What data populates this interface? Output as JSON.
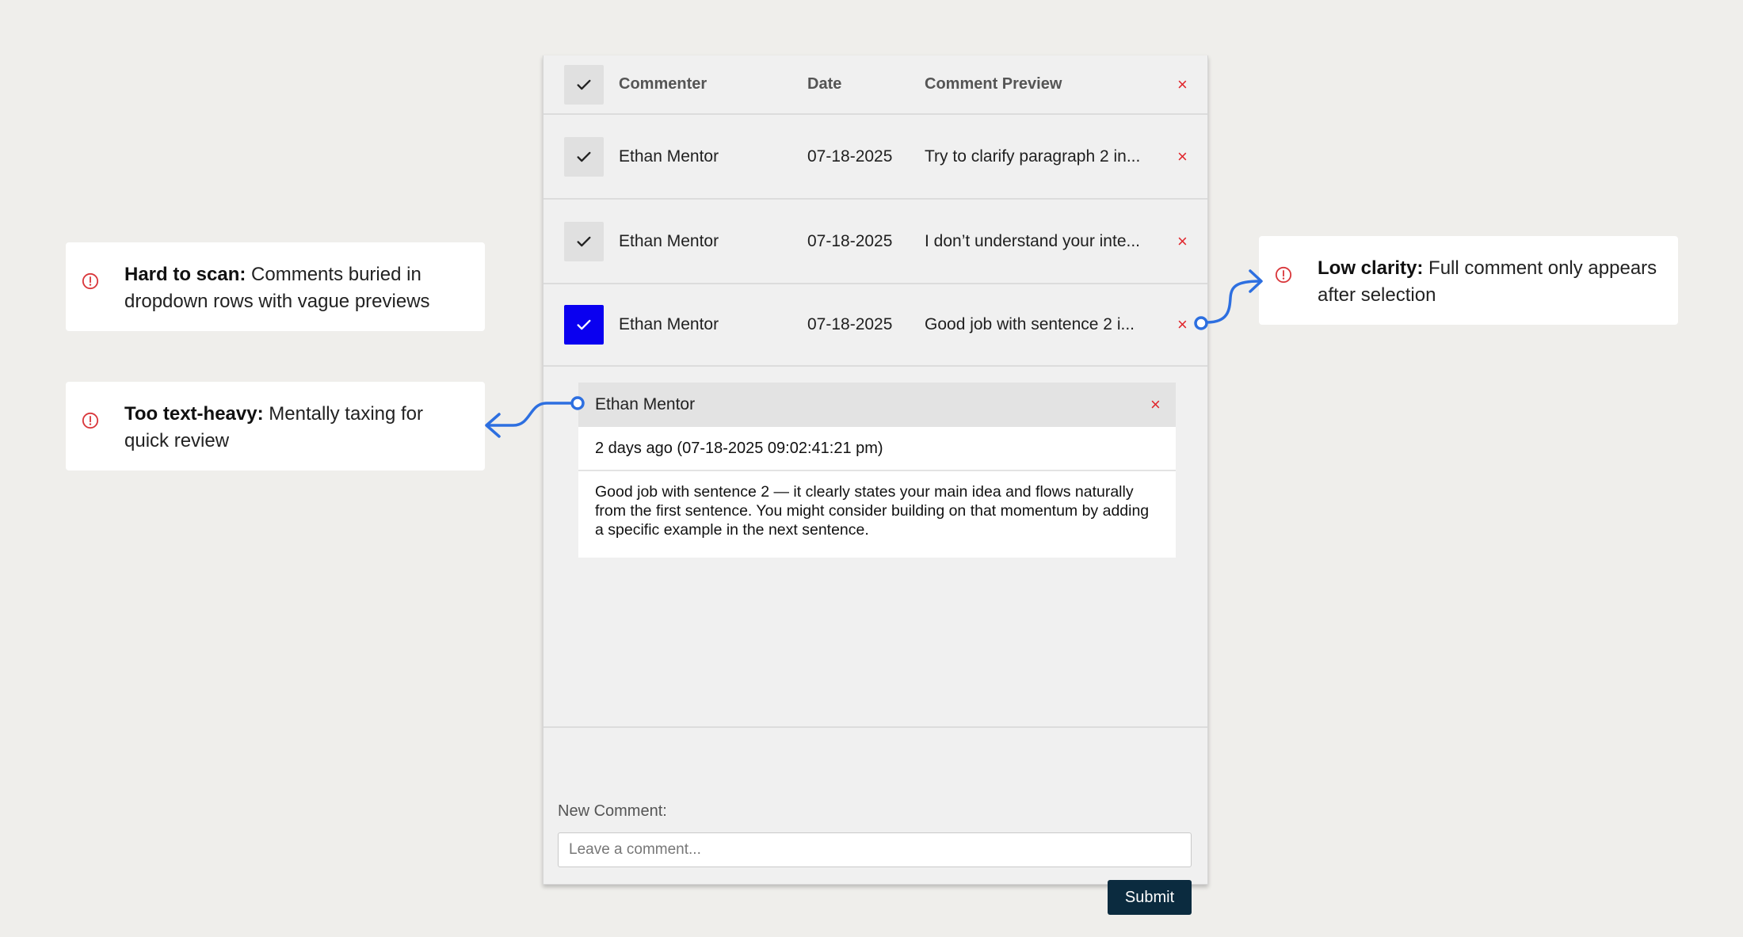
{
  "table": {
    "header": {
      "commenter": "Commenter",
      "date": "Date",
      "preview": "Comment Preview",
      "remove": "×"
    },
    "rows": [
      {
        "commenter": "Ethan Mentor",
        "date": "07-18-2025",
        "preview": "Try to clarify paragraph 2 in...",
        "remove": "×",
        "checked": false
      },
      {
        "commenter": "Ethan Mentor",
        "date": "07-18-2025",
        "preview": "I don’t understand your inte...",
        "remove": "×",
        "checked": false
      },
      {
        "commenter": "Ethan Mentor",
        "date": "07-18-2025",
        "preview": "Good job with sentence 2 i...",
        "remove": "×",
        "checked": true
      }
    ]
  },
  "detail": {
    "commenter": "Ethan Mentor",
    "close": "×",
    "timestamp": "2 days ago (07-18-2025 09:02:41:21 pm)",
    "body": "Good job with sentence 2 — it clearly states your main idea and flows naturally from the first sentence. You might consider building on that momentum by adding a specific example in the next sentence."
  },
  "new_comment": {
    "label": "New Comment:",
    "placeholder": "Leave a comment...",
    "value": "",
    "submit_label": "Submit"
  },
  "callouts": [
    {
      "title": "Hard to scan:",
      "text": " Comments buried in dropdown rows with vague previews",
      "icon": "alert-circle-icon"
    },
    {
      "title": "Too text-heavy:",
      "text": " Mentally taxing for quick review",
      "icon": "alert-circle-icon"
    },
    {
      "title": "Low clarity:",
      "text": " Full comment only appears after selection",
      "icon": "alert-circle-icon"
    }
  ],
  "colors": {
    "background": "#efeeeb",
    "panel": "#f0f0f0",
    "checked": "#0a00f0",
    "remove": "#e0282e",
    "submit": "#0b2b3f",
    "connector": "#2d6fe0",
    "warning": "#d9373b"
  }
}
